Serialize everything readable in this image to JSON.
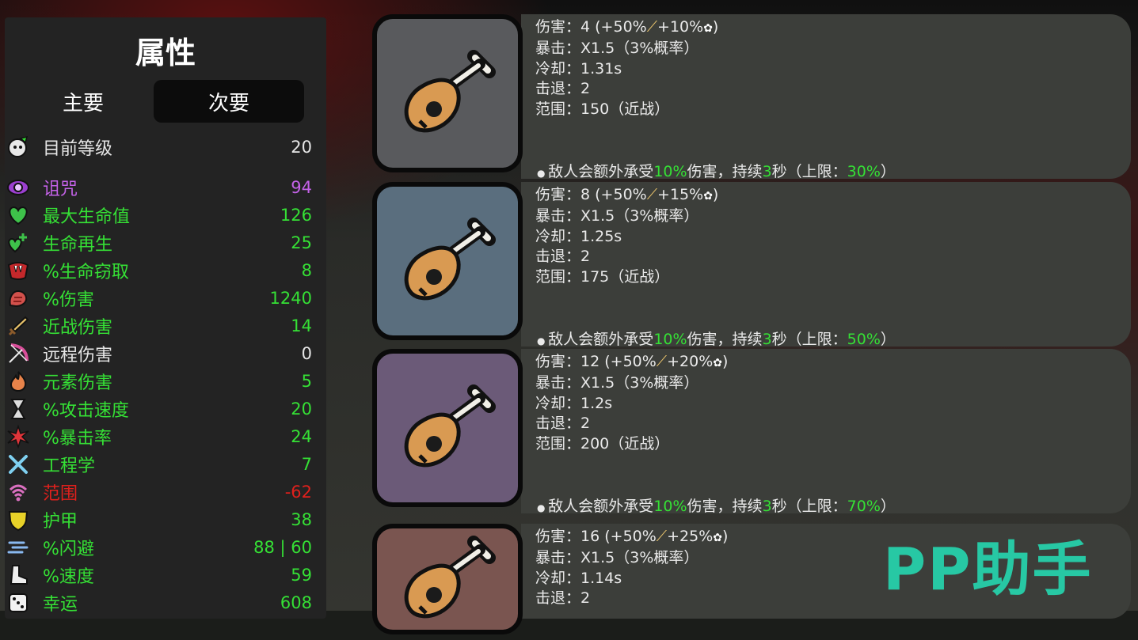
{
  "panel": {
    "title": "属性",
    "tabs": {
      "primary": "主要",
      "secondary": "次要"
    },
    "level": {
      "label": "目前等级",
      "value": "20"
    },
    "stats": [
      {
        "label": "诅咒",
        "value": "94",
        "color": "#c462e8",
        "icon": "curse-eye-icon"
      },
      {
        "label": "最大生命值",
        "value": "126",
        "color": "#35e035",
        "icon": "heart-icon"
      },
      {
        "label": "生命再生",
        "value": "25",
        "color": "#35e035",
        "icon": "heart-plus-icon"
      },
      {
        "label": "%生命窃取",
        "value": "8",
        "color": "#35e035",
        "icon": "fang-mouth-icon"
      },
      {
        "label": "%伤害",
        "value": "1240",
        "color": "#35e035",
        "icon": "muscle-icon"
      },
      {
        "label": "近战伤害",
        "value": "14",
        "color": "#35e035",
        "icon": "sword-icon"
      },
      {
        "label": "远程伤害",
        "value": "0",
        "color": "#e6e6e6",
        "icon": "bow-icon"
      },
      {
        "label": "元素伤害",
        "value": "5",
        "color": "#35e035",
        "icon": "flame-icon"
      },
      {
        "label": "%攻击速度",
        "value": "20",
        "color": "#35e035",
        "icon": "hourglass-icon"
      },
      {
        "label": "%暴击率",
        "value": "24",
        "color": "#35e035",
        "icon": "crit-burst-icon"
      },
      {
        "label": "工程学",
        "value": "7",
        "color": "#35e035",
        "icon": "wrench-cross-icon"
      },
      {
        "label": "范围",
        "value": "-62",
        "color": "#e0201c",
        "icon": "range-signal-icon"
      },
      {
        "label": "护甲",
        "value": "38",
        "color": "#35e035",
        "icon": "shield-icon"
      },
      {
        "label": "%闪避",
        "value": "88 | 60",
        "color": "#35e035",
        "icon": "dodge-wind-icon"
      },
      {
        "label": "%速度",
        "value": "59",
        "color": "#35e035",
        "icon": "boot-icon"
      },
      {
        "label": "幸运",
        "value": "608",
        "color": "#35e035",
        "icon": "dice-icon"
      }
    ]
  },
  "weapons": [
    {
      "tier_color": "#595a5d",
      "icon": "lute-icon",
      "damage_label": "伤害：",
      "damage_base": "4 (+50%",
      "damage_mid": "+10%",
      "damage_end": ")",
      "crit": "暴击：X1.5（3%概率）",
      "cooldown": "冷却：1.31s",
      "knockback": "击退：2",
      "range": "范围：150（近战）",
      "effect_pre": "敌人会额外承受",
      "effect_pct": "10%",
      "effect_mid": "伤害，持续",
      "effect_sec": "3",
      "effect_post": "秒（上限：",
      "effect_cap": "30%",
      "effect_close": "）"
    },
    {
      "tier_color": "#5a6e7e",
      "icon": "lute-icon",
      "damage_label": "伤害：",
      "damage_base": "8 (+50%",
      "damage_mid": "+15%",
      "damage_end": ")",
      "crit": "暴击：X1.5（3%概率）",
      "cooldown": "冷却：1.25s",
      "knockback": "击退：2",
      "range": "范围：175（近战）",
      "effect_pre": "敌人会额外承受",
      "effect_pct": "10%",
      "effect_mid": "伤害，持续",
      "effect_sec": "3",
      "effect_post": "秒（上限：",
      "effect_cap": "50%",
      "effect_close": "）"
    },
    {
      "tier_color": "#6b5a78",
      "icon": "lute-icon",
      "damage_label": "伤害：",
      "damage_base": "12 (+50%",
      "damage_mid": "+20%",
      "damage_end": ")",
      "crit": "暴击：X1.5（3%概率）",
      "cooldown": "冷却：1.2s",
      "knockback": "击退：2",
      "range": "范围：200（近战）",
      "effect_pre": "敌人会额外承受",
      "effect_pct": "10%",
      "effect_mid": "伤害，持续",
      "effect_sec": "3",
      "effect_post": "秒（上限：",
      "effect_cap": "70%",
      "effect_close": "）"
    },
    {
      "tier_color": "#7a5550",
      "icon": "lute-icon",
      "damage_label": "伤害：",
      "damage_base": "16 (+50%",
      "damage_mid": "+25%",
      "damage_end": ")",
      "crit": "暴击：X1.5（3%概率）",
      "cooldown": "冷却：1.14s",
      "knockback": "击退：2"
    }
  ],
  "watermark": "PP助手"
}
